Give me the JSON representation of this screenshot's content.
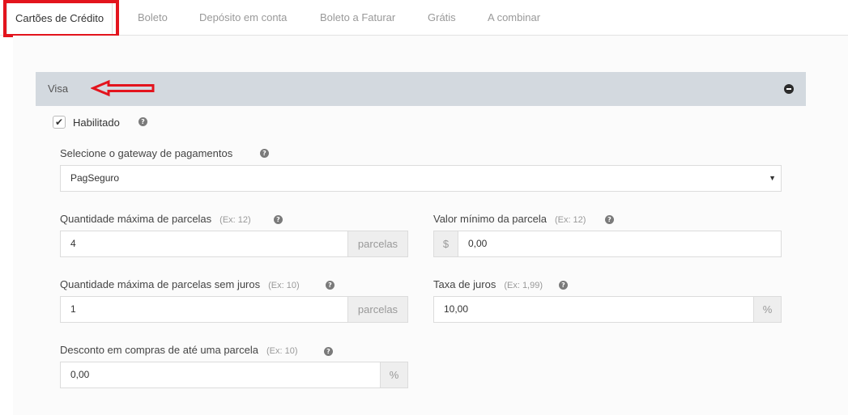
{
  "tabs": [
    {
      "label": "Cartões de Crédito",
      "active": true
    },
    {
      "label": "Boleto"
    },
    {
      "label": "Depósito em conta"
    },
    {
      "label": "Boleto a Faturar"
    },
    {
      "label": "Grátis"
    },
    {
      "label": "A combinar"
    }
  ],
  "card": {
    "title": "Visa",
    "collapse_icon": "minus-circle-icon"
  },
  "enabled": {
    "label": "Habilitado",
    "checked": true
  },
  "gateway": {
    "label": "Selecione o gateway de pagamentos",
    "value": "PagSeguro"
  },
  "max_installments": {
    "label": "Quantidade máxima de parcelas",
    "hint": "(Ex: 12)",
    "value": "4",
    "suffix": "parcelas"
  },
  "min_installment": {
    "label": "Valor mínimo da parcela",
    "hint": "(Ex: 12)",
    "prefix": "$",
    "value": "0,00"
  },
  "max_interest_free": {
    "label": "Quantidade máxima de parcelas sem juros",
    "hint": "(Ex: 10)",
    "value": "1",
    "suffix": "parcelas"
  },
  "interest_rate": {
    "label": "Taxa de juros",
    "hint": "(Ex: 1,99)",
    "value": "10,00",
    "suffix": "%"
  },
  "single_discount": {
    "label": "Desconto em compras de até uma parcela",
    "hint": "(Ex: 10)",
    "value": "0,00",
    "suffix": "%"
  },
  "colors": {
    "highlight": "#e3141d",
    "card_header": "#d3d9df"
  }
}
